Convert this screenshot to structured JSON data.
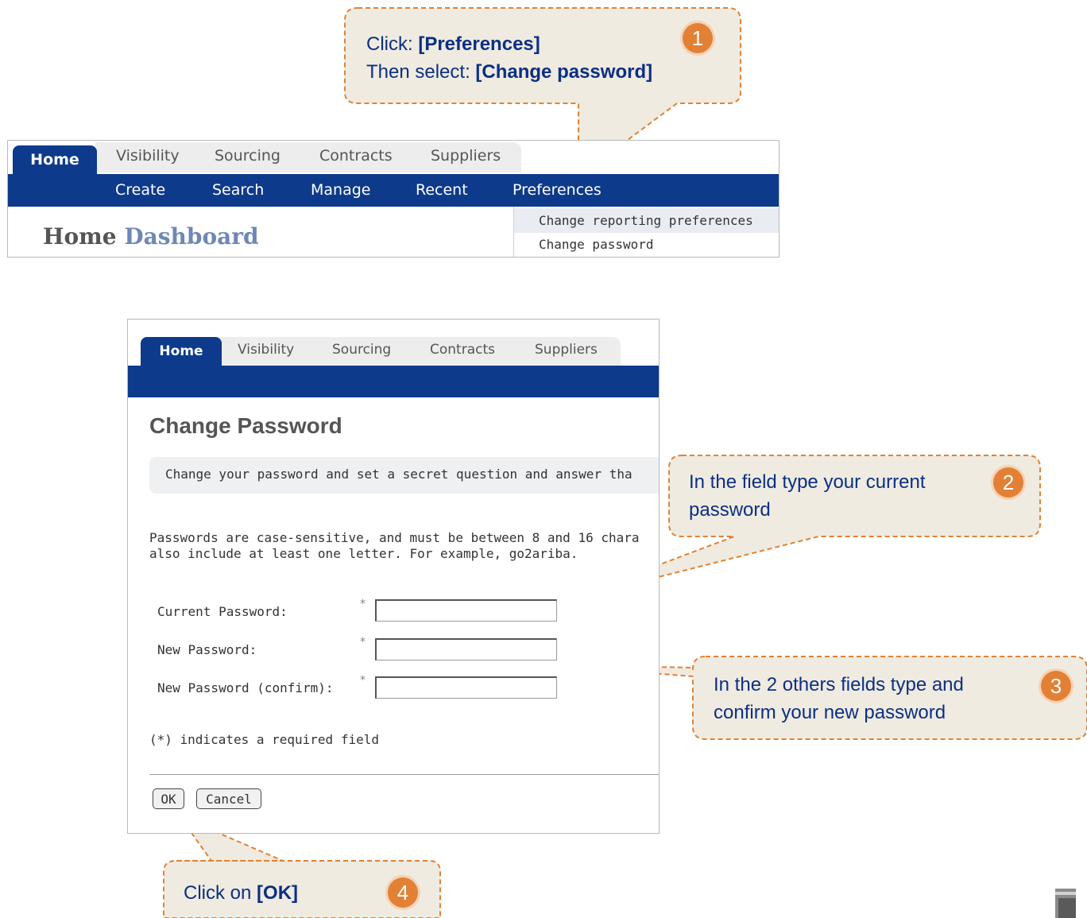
{
  "top_screenshot": {
    "tabs": [
      "Home",
      "Visibility",
      "Sourcing",
      "Contracts",
      "Suppliers"
    ],
    "nav": [
      "Create",
      "Search",
      "Manage",
      "Recent",
      "Preferences"
    ],
    "dropdown": [
      "Change reporting preferences",
      "Change password"
    ],
    "dashboard_title_1": "Home",
    "dashboard_title_2": "Dashboard"
  },
  "change_password": {
    "tabs": [
      "Home",
      "Visibility",
      "Sourcing",
      "Contracts",
      "Suppliers"
    ],
    "title": "Change Password",
    "description": "Change your password and set a secret question and answer tha",
    "rules_line1": "Passwords are case-sensitive, and must be between 8 and 16 chara",
    "rules_line2": "also include at least one letter. For example, go2ariba.",
    "fields": [
      {
        "label": "Current Password:",
        "required": "*",
        "value": ""
      },
      {
        "label": "New Password:",
        "required": "*",
        "value": ""
      },
      {
        "label": "New Password (confirm):",
        "required": "*",
        "value": ""
      }
    ],
    "required_note": "(*) indicates a required field",
    "ok_label": "OK",
    "cancel_label": "Cancel"
  },
  "callouts": [
    {
      "number": "1",
      "lines": [
        [
          "Click: ",
          "[Preferences]"
        ],
        [
          "Then select: ",
          "[Change password]"
        ]
      ]
    },
    {
      "number": "2",
      "lines": [
        [
          "In the field type your current",
          ""
        ],
        [
          "password",
          ""
        ]
      ]
    },
    {
      "number": "3",
      "lines": [
        [
          "In the 2 others fields type and",
          ""
        ],
        [
          "confirm your new password",
          ""
        ]
      ]
    },
    {
      "number": "4",
      "lines": [
        [
          "Click on ",
          "[OK]"
        ]
      ]
    }
  ],
  "colors": {
    "nav_blue": "#0e3a8c",
    "callout_fill": "#efebe0",
    "callout_border": "#e28135",
    "callout_text": "#0b2f84",
    "badge": "#e28135"
  }
}
